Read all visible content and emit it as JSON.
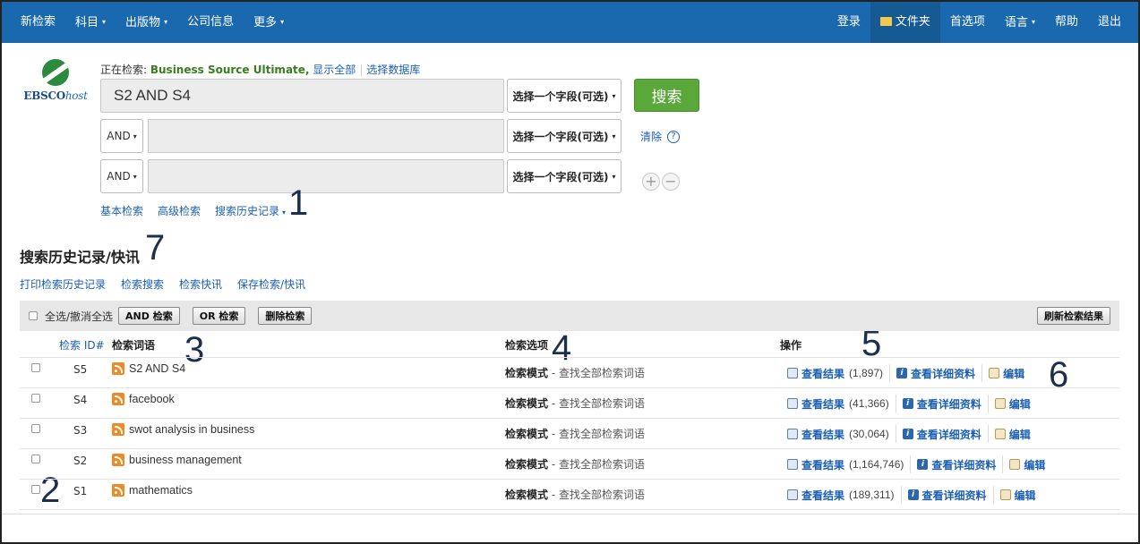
{
  "nav": {
    "left": [
      {
        "label": "新检索",
        "caret": false
      },
      {
        "label": "科目",
        "caret": true
      },
      {
        "label": "出版物",
        "caret": true
      },
      {
        "label": "公司信息",
        "caret": false
      },
      {
        "label": "更多",
        "caret": true
      }
    ],
    "right": [
      {
        "label": "登录"
      },
      {
        "label": "文件夹"
      },
      {
        "label": "首选项"
      },
      {
        "label": "语言"
      },
      {
        "label": "帮助"
      },
      {
        "label": "退出"
      }
    ],
    "caret_glyph": "▾"
  },
  "logo": {
    "brand": "EBSCO",
    "suffix": "host"
  },
  "searching": {
    "prefix": "正在检索: ",
    "database": "Business Source Ultimate,",
    "show_all": "显示全部",
    "choose_db": "选择数据库"
  },
  "search_rows": [
    {
      "bool": "",
      "term": "S2 AND S4",
      "field": "选择一个字段(可选)"
    },
    {
      "bool": "AND",
      "term": "",
      "field": "选择一个字段(可选)"
    },
    {
      "bool": "AND",
      "term": "",
      "field": "选择一个字段(可选)"
    }
  ],
  "search_button": "搜索",
  "clear": {
    "label": "清除",
    "help": "?"
  },
  "plus": "+",
  "minus": "−",
  "search_links": {
    "basic": "基本检索",
    "advanced": "高级检索",
    "history": "搜索历史记录"
  },
  "annotations": {
    "n1": "1",
    "n2": "2",
    "n3": "3",
    "n4": "4",
    "n5": "5",
    "n6": "6",
    "n7": "7"
  },
  "history": {
    "title": "搜索历史记录/快讯",
    "links": [
      "打印检索历史记录",
      "检索搜索",
      "检索快讯",
      "保存检索/快讯"
    ],
    "toolbar": {
      "select_all": "全选/撤消全选",
      "and_search": "AND 检索",
      "or_search": "OR 检索",
      "delete": "删除检索",
      "refresh": "刷新检索结果"
    },
    "headers": {
      "id": "检索 ID#",
      "term": "检索词语",
      "options": "检索选项",
      "actions": "操作"
    },
    "action_labels": {
      "view": "查看结果",
      "details": "查看详细资料",
      "edit": "编辑"
    },
    "mode_label": "检索模式",
    "mode_value": " - 查找全部检索词语",
    "rows": [
      {
        "id": "S5",
        "term": "S2 AND S4",
        "count": "(1,897)"
      },
      {
        "id": "S4",
        "term": "facebook",
        "count": "(41,366)"
      },
      {
        "id": "S3",
        "term": "swot analysis in business",
        "count": "(30,064)"
      },
      {
        "id": "S2",
        "term": "business management",
        "count": "(1,164,746)"
      },
      {
        "id": "S1",
        "term": "mathematics",
        "count": "(189,311)"
      }
    ]
  }
}
